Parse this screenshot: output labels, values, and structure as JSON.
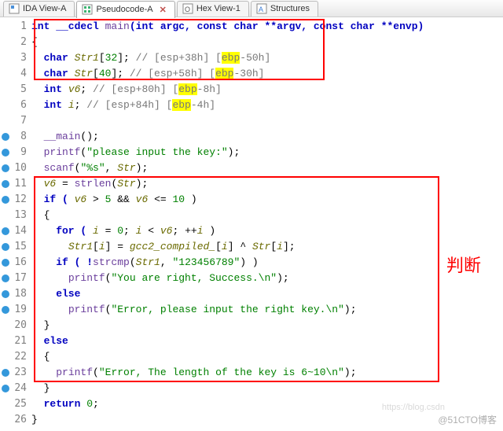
{
  "tabs": [
    {
      "label": "IDA View-A",
      "icon": "ida",
      "active": false,
      "closable": false
    },
    {
      "label": "Pseudocode-A",
      "icon": "pseudocode",
      "active": true,
      "closable": true
    },
    {
      "label": "Hex View-1",
      "icon": "hex",
      "active": false,
      "closable": false
    },
    {
      "label": "Structures",
      "icon": "struct",
      "active": false,
      "closable": false
    }
  ],
  "lines": [
    1,
    2,
    3,
    4,
    5,
    6,
    7,
    8,
    9,
    10,
    11,
    12,
    13,
    14,
    15,
    16,
    17,
    18,
    19,
    20,
    21,
    22,
    23,
    24,
    25,
    26
  ],
  "breakpoints": [
    8,
    9,
    10,
    11,
    12,
    14,
    15,
    16,
    17,
    18,
    19,
    23,
    24
  ],
  "code": {
    "l1_sig_pre": "int __cdecl ",
    "l1_fn": "main",
    "l1_sig_post": "(int argc, const char **argv, const char **envp)",
    "l2": "{",
    "l3_a": "  char ",
    "l3_b": "Str1",
    "l3_c": "[",
    "l3_d": "32",
    "l3_e": "]; ",
    "l3_cmt": "// [esp+38h] [",
    "l3_reg": "ebp",
    "l3_cmt2": "-50h]",
    "l4_a": "  char ",
    "l4_b": "Str",
    "l4_c": "[",
    "l4_d": "40",
    "l4_e": "]; ",
    "l4_cmt": "// [esp+58h] [",
    "l4_reg": "ebp",
    "l4_cmt2": "-30h]",
    "l5_a": "  int ",
    "l5_b": "v6",
    "l5_c": "; ",
    "l5_cmt": "// [esp+80h] [",
    "l5_reg": "ebp",
    "l5_cmt2": "-8h]",
    "l6_a": "  int ",
    "l6_b": "i",
    "l6_c": "; ",
    "l6_cmt": "// [esp+84h] [",
    "l6_reg": "ebp",
    "l6_cmt2": "-4h]",
    "l7": "",
    "l8_a": "  ",
    "l8_fn": "__main",
    "l8_b": "();",
    "l9_a": "  ",
    "l9_fn": "printf",
    "l9_b": "(",
    "l9_str": "\"please input the key:\"",
    "l9_c": ");",
    "l10_a": "  ",
    "l10_fn": "scanf",
    "l10_b": "(",
    "l10_str": "\"%s\"",
    "l10_c": ", ",
    "l10_v": "Str",
    "l10_d": ");",
    "l11_a": "  ",
    "l11_v": "v6",
    "l11_b": " = ",
    "l11_fn": "strlen",
    "l11_c": "(",
    "l11_v2": "Str",
    "l11_d": ");",
    "l12_a": "  if ( ",
    "l12_v": "v6",
    "l12_b": " > ",
    "l12_n": "5",
    "l12_c": " && ",
    "l12_v2": "v6",
    "l12_d": " <= ",
    "l12_n2": "10",
    "l12_e": " )",
    "l13": "  {",
    "l14_a": "    for ( ",
    "l14_v": "i",
    "l14_b": " = ",
    "l14_n": "0",
    "l14_c": "; ",
    "l14_v2": "i",
    "l14_d": " < ",
    "l14_v3": "v6",
    "l14_e": "; ++",
    "l14_v4": "i",
    "l14_f": " )",
    "l15_a": "      ",
    "l15_v": "Str1",
    "l15_b": "[",
    "l15_v2": "i",
    "l15_c": "] = ",
    "l15_v3": "gcc2_compiled_",
    "l15_d": "[",
    "l15_v4": "i",
    "l15_e": "] ^ ",
    "l15_v5": "Str",
    "l15_f": "[",
    "l15_v6": "i",
    "l15_g": "];",
    "l16_a": "    if ( !",
    "l16_fn": "strcmp",
    "l16_b": "(",
    "l16_v": "Str1",
    "l16_c": ", ",
    "l16_str": "\"123456789\"",
    "l16_d": ") )",
    "l17_a": "      ",
    "l17_fn": "printf",
    "l17_b": "(",
    "l17_str": "\"You are right, Success.\\n\"",
    "l17_c": ");",
    "l18_a": "    else",
    "l19_a": "      ",
    "l19_fn": "printf",
    "l19_b": "(",
    "l19_str": "\"Error, please input the right key.\\n\"",
    "l19_c": ");",
    "l20": "  }",
    "l21_a": "  else",
    "l22": "  {",
    "l23_a": "    ",
    "l23_fn": "printf",
    "l23_b": "(",
    "l23_str": "\"Error, The length of the key is 6~10\\n\"",
    "l23_c": ");",
    "l24": "  }",
    "l25_a": "  return ",
    "l25_n": "0",
    "l25_b": ";",
    "l26": "}"
  },
  "annotation": "判断",
  "watermark1": "@51CTO博客",
  "watermark2": "https://blog.csdn"
}
